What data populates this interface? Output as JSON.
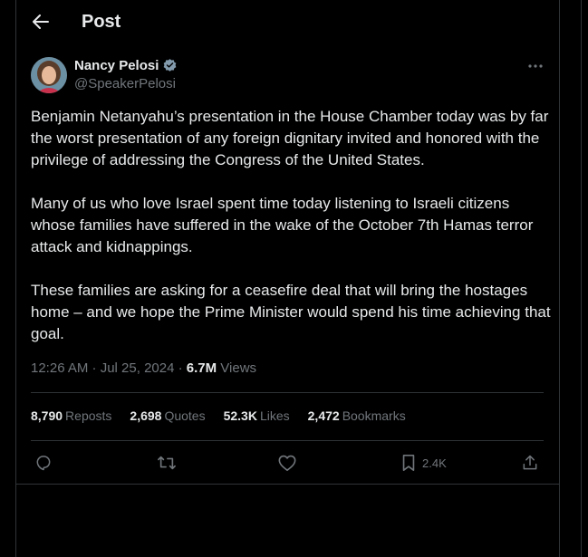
{
  "header": {
    "title": "Post"
  },
  "author": {
    "name": "Nancy Pelosi",
    "handle": "@SpeakerPelosi",
    "verified": true
  },
  "tweet": {
    "paragraphs": [
      "Benjamin Netanyahu’s presentation in the House Chamber today was by far the worst presentation of any foreign dignitary invited and honored with the privilege of addressing the Congress of the United States.",
      "Many of us who love Israel spent time today listening to Israeli citizens whose families have suffered in the wake of the October 7th Hamas terror attack and kidnappings.",
      "These families are asking for a ceasefire deal that will bring the hostages home – and we hope the Prime Minister would spend his time achieving that goal."
    ],
    "timestamp": "12:26 AM · Jul 25, 2024 · ",
    "views_count": "6.7M",
    "views_label": " Views"
  },
  "stats": {
    "reposts_count": "8,790",
    "reposts_label": "Reposts",
    "quotes_count": "2,698",
    "quotes_label": "Quotes",
    "likes_count": "52.3K",
    "likes_label": "Likes",
    "bookmarks_count": "2,472",
    "bookmarks_label": "Bookmarks"
  },
  "actions": {
    "bookmark_count": "2.4K",
    "icons": [
      "reply-icon",
      "repost-icon",
      "like-icon",
      "bookmark-icon",
      "share-icon"
    ]
  },
  "colors": {
    "background": "#000000",
    "text": "#e7e9ea",
    "muted": "#71767b",
    "border": "#2f3336",
    "verified": "#829aab"
  }
}
